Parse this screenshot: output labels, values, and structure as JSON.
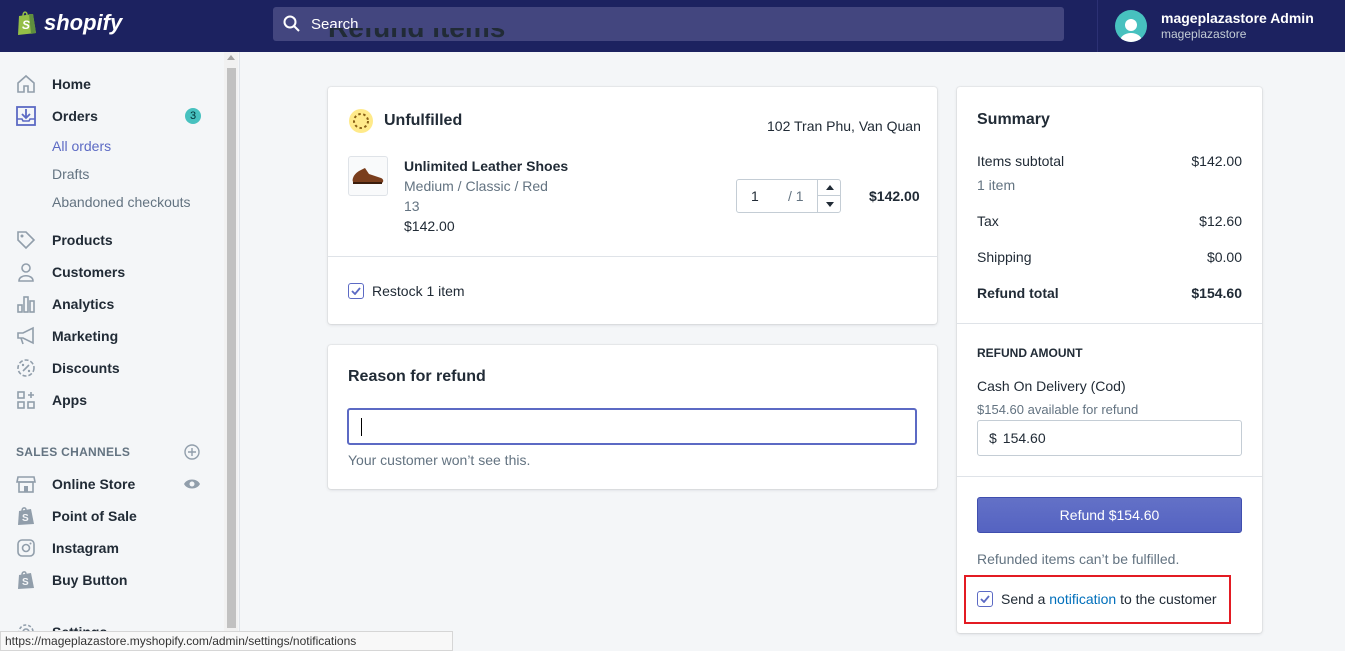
{
  "topbar": {
    "logo_text": "shopify",
    "search_placeholder": "Search",
    "user_name": "mageplazastore Admin",
    "user_store": "mageplazastore"
  },
  "sidebar": {
    "items": [
      {
        "label": "Home",
        "icon": "home-icon"
      },
      {
        "label": "Orders",
        "icon": "orders-icon",
        "badge": "3"
      },
      {
        "label": "Products",
        "icon": "tag-icon"
      },
      {
        "label": "Customers",
        "icon": "person-icon"
      },
      {
        "label": "Analytics",
        "icon": "bar-chart-icon"
      },
      {
        "label": "Marketing",
        "icon": "megaphone-icon"
      },
      {
        "label": "Discounts",
        "icon": "discount-icon"
      },
      {
        "label": "Apps",
        "icon": "apps-icon"
      }
    ],
    "orders_sub": [
      "All orders",
      "Drafts",
      "Abandoned checkouts"
    ],
    "sales_channels_heading": "SALES CHANNELS",
    "channels": [
      {
        "label": "Online Store",
        "icon": "store-icon"
      },
      {
        "label": "Point of Sale",
        "icon": "shopify-bag-icon"
      },
      {
        "label": "Instagram",
        "icon": "instagram-icon"
      },
      {
        "label": "Buy Button",
        "icon": "shopify-bag-icon"
      }
    ],
    "settings_label": "Settings"
  },
  "page": {
    "title": "Refund items"
  },
  "items_card": {
    "status": "Unfulfilled",
    "address": "102 Tran Phu, Van Quan",
    "product_name": "Unlimited Leather Shoes",
    "variant": "Medium / Classic / Red",
    "variant_extra": "13",
    "unit_price": "$142.00",
    "quantity": "1",
    "quantity_max": "/ 1",
    "line_total": "$142.00",
    "restock_label": "Restock 1 item"
  },
  "reason_card": {
    "title": "Reason for refund",
    "input_value": "",
    "help_text": "Your customer won’t see this."
  },
  "summary": {
    "title": "Summary",
    "items_subtotal_label": "Items subtotal",
    "items_subtotal_value": "$142.00",
    "items_count": "1 item",
    "tax_label": "Tax",
    "tax_value": "$12.60",
    "shipping_label": "Shipping",
    "shipping_value": "$0.00",
    "refund_total_label": "Refund total",
    "refund_total_value": "$154.60",
    "refund_amount_heading": "REFUND AMOUNT",
    "payment_method": "Cash On Delivery (Cod)",
    "available": "$154.60 available for refund",
    "currency_prefix": "$",
    "amount_value": "154.60",
    "refund_button": "Refund $154.60",
    "refund_note": "Refunded items can’t be fulfilled.",
    "notify_prefix": "Send a",
    "notify_link": "notification",
    "notify_suffix": "to the customer"
  },
  "status_bar_url": "https://mageplazastore.myshopify.com/admin/settings/notifications",
  "colors": {
    "topbar": "#1c2260",
    "accent": "#5c6ac4",
    "highlight": "#e31b23",
    "badge": "#47c1bf"
  }
}
